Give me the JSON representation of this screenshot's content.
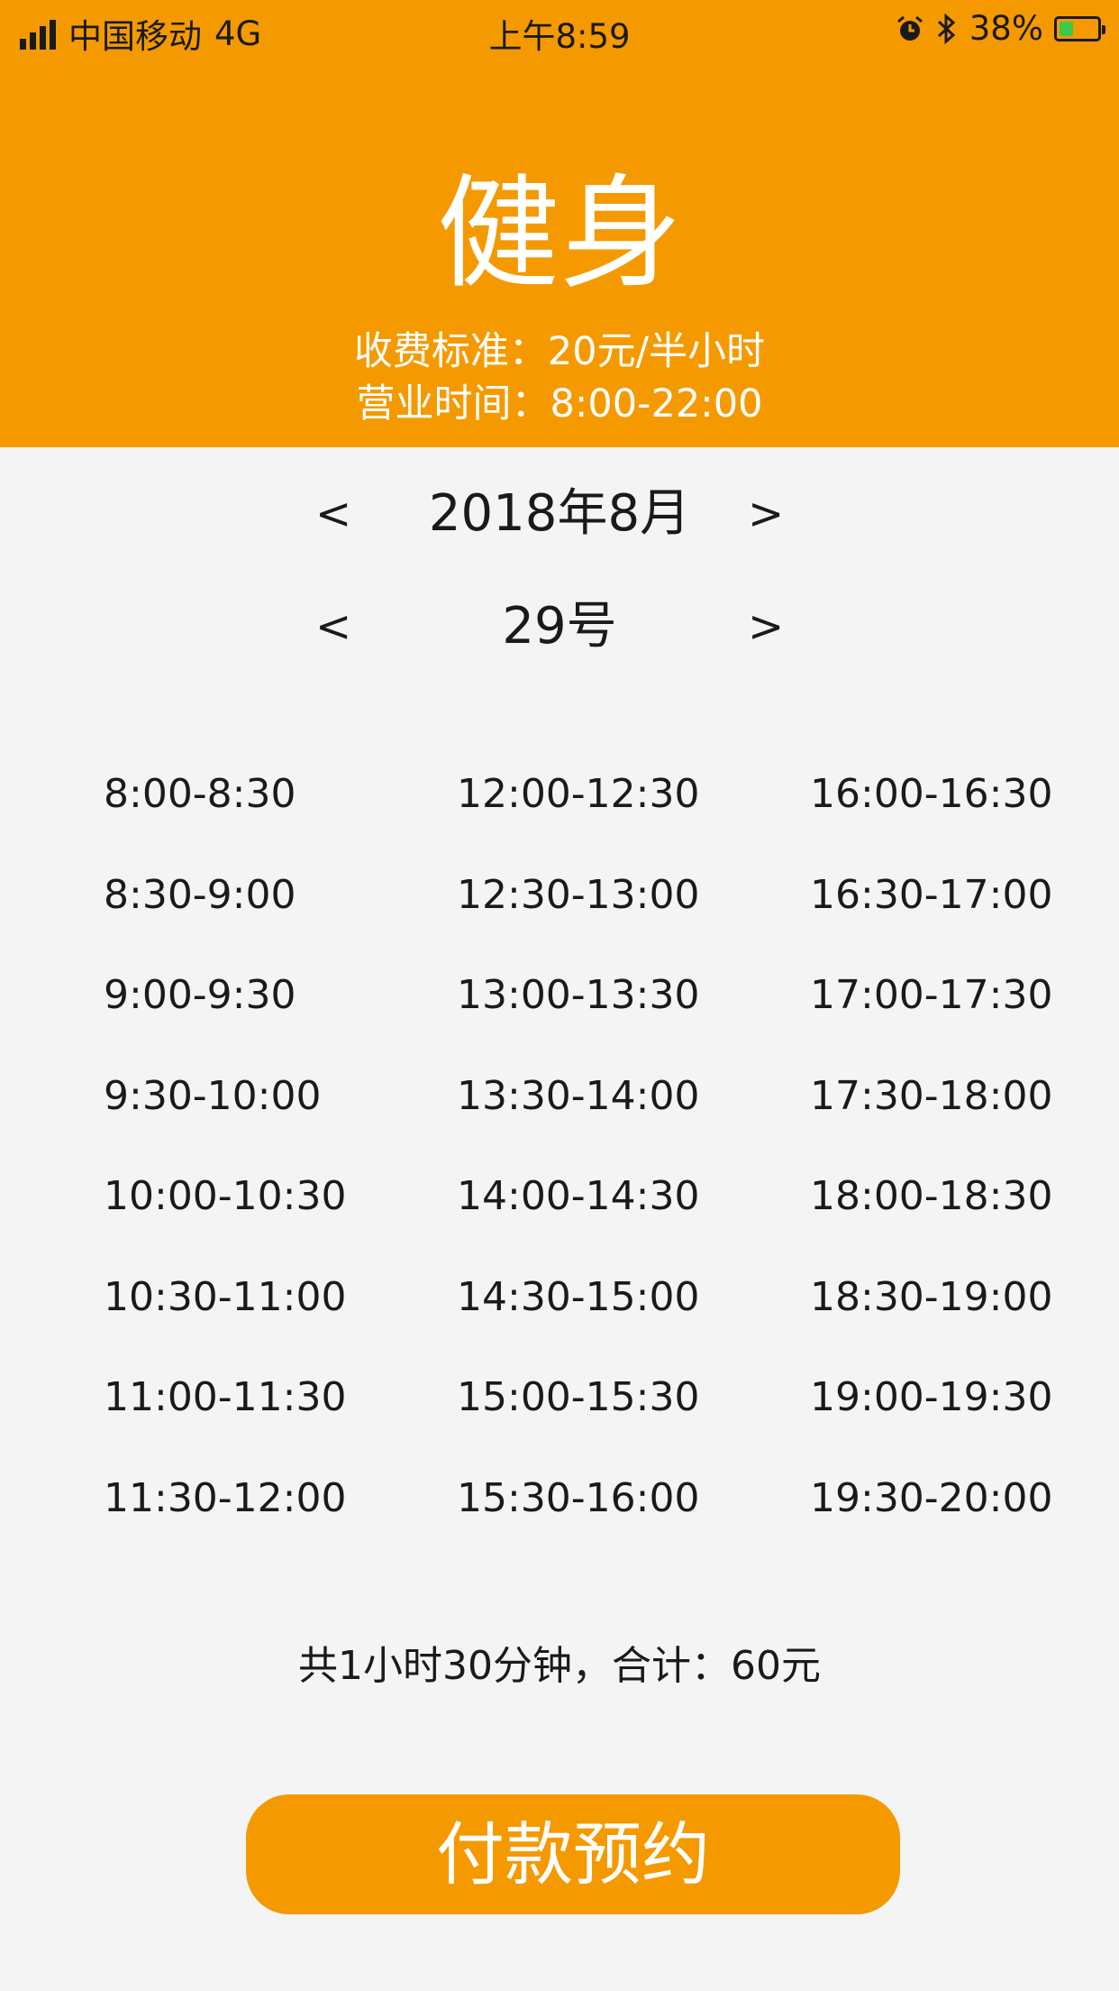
{
  "status_bar": {
    "carrier": "中国移动",
    "network": "4G",
    "time": "上午8:59",
    "battery": "38%",
    "battery_level": 0.38
  },
  "header": {
    "title": "健身",
    "price": "收费标准：20元/半小时",
    "hours": "营业时间：8:00-22:00"
  },
  "month_nav": {
    "prev": "<",
    "label": "2018年8月",
    "next": ">"
  },
  "day_nav": {
    "prev": "<",
    "label": "29号",
    "next": ">"
  },
  "slots": [
    [
      "8:00-8:30",
      "8:30-9:00",
      "9:00-9:30",
      "9:30-10:00",
      "10:00-10:30",
      "10:30-11:00",
      "11:00-11:30",
      "11:30-12:00"
    ],
    [
      "12:00-12:30",
      "12:30-13:00",
      "13:00-13:30",
      "13:30-14:00",
      "14:00-14:30",
      "14:30-15:00",
      "15:00-15:30",
      "15:30-16:00"
    ],
    [
      "16:00-16:30",
      "16:30-17:00",
      "17:00-17:30",
      "17:30-18:00",
      "18:00-18:30",
      "18:30-19:00",
      "19:00-19:30",
      "19:30-20:00"
    ]
  ],
  "summary": "共1小时30分钟，合计：60元",
  "pay_button": "付款预约",
  "colors": {
    "accent": "#f49a00",
    "background": "#f4f4f4",
    "battery": "#3cc84a"
  }
}
